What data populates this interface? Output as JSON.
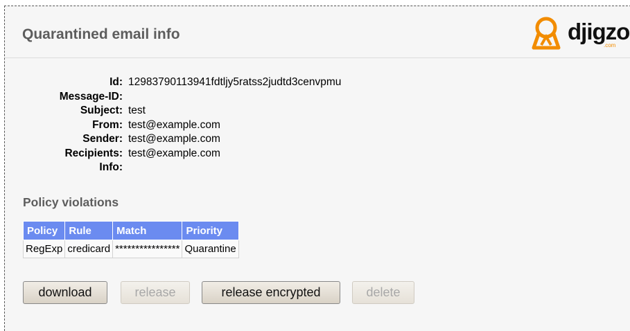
{
  "header": {
    "title": "Quarantined email info",
    "logo_text": "djigzo",
    "logo_sub": ".com"
  },
  "info": [
    {
      "label": "Id:",
      "value": "12983790113941fdtljy5ratss2judtd3cenvpmu"
    },
    {
      "label": "Message-ID:",
      "value": ""
    },
    {
      "label": "Subject:",
      "value": "test"
    },
    {
      "label": "From:",
      "value": "test@example.com"
    },
    {
      "label": "Sender:",
      "value": "test@example.com"
    },
    {
      "label": "Recipients:",
      "value": "test@example.com"
    },
    {
      "label": "Info:",
      "value": ""
    }
  ],
  "policy": {
    "title": "Policy violations",
    "columns": [
      "Policy",
      "Rule",
      "Match",
      "Priority"
    ],
    "rows": [
      [
        "RegExp",
        "credicard",
        "****************",
        "Quarantine"
      ]
    ]
  },
  "buttons": {
    "download": "download",
    "release": "release",
    "release_encrypted": "release encrypted",
    "delete": "delete"
  },
  "colors": {
    "table_header": "#6b8bf0",
    "logo_orange": "#f28c00"
  }
}
